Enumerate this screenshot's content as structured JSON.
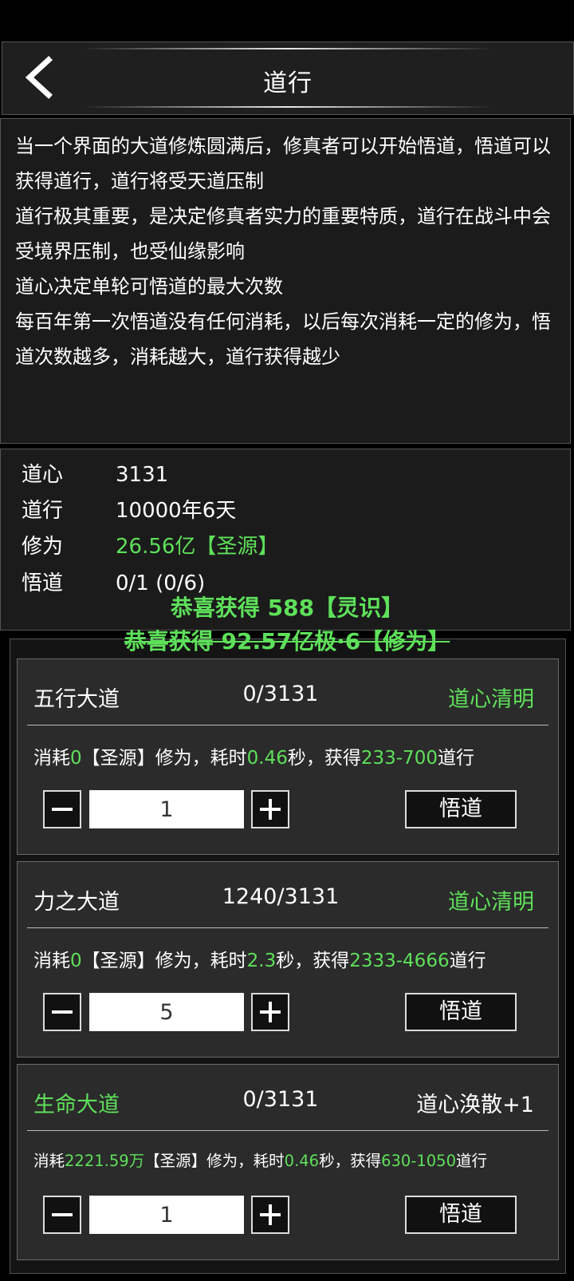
{
  "header": {
    "title": "道行"
  },
  "description": [
    "当一个界面的大道修炼圆满后，修真者可以开始悟道，悟道可以获得道行，道行将受天道压制",
    "道行极其重要，是决定修真者实力的重要特质，道行在战斗中会受境界压制，也受仙缘影响",
    "道心决定单轮可悟道的最大次数",
    "每百年第一次悟道没有任何消耗，以后每次消耗一定的修为，悟道次数越多，消耗越大，道行获得越少"
  ],
  "stats": {
    "daoxin": {
      "label": "道心",
      "value": "3131"
    },
    "daoxing": {
      "label": "道行",
      "value": "10000年6天"
    },
    "xiuwei": {
      "label": "修为",
      "value": "26.56亿【圣源】"
    },
    "wudao": {
      "label": "悟道",
      "value": "0/1 (0/6)"
    }
  },
  "toasts": [
    "恭喜获得 588【灵识】",
    "恭喜获得 92.57亿极·6【修为】"
  ],
  "cards": [
    {
      "name": "五行大道",
      "progress": "0/3131",
      "state": "道心清明",
      "cost": {
        "p1": "消耗",
        "v1": "0",
        "p2": "【圣源】修为，耗时",
        "v2": "0.46",
        "p3": "秒，获得",
        "v3": "233-700",
        "p4": "道行"
      },
      "qty": "1",
      "button": "悟道"
    },
    {
      "name": "力之大道",
      "progress": "1240/3131",
      "state": "道心清明",
      "cost": {
        "p1": "消耗",
        "v1": "0",
        "p2": "【圣源】修为，耗时",
        "v2": "2.3",
        "p3": "秒，获得",
        "v3": "2333-4666",
        "p4": "道行"
      },
      "qty": "5",
      "button": "悟道"
    },
    {
      "name": "生命大道",
      "progress": "0/3131",
      "state": "道心涣散+1",
      "cost": {
        "p1": "消耗",
        "v1": "2221.59万",
        "p2": "【圣源】修为，耗时",
        "v2": "0.46",
        "p3": "秒，获得",
        "v3": "630-1050",
        "p4": "道行"
      },
      "qty": "1",
      "button": "悟道"
    }
  ],
  "colors": {
    "accent_green": "#5ee05a",
    "panel": "#1b1b1b",
    "card": "#2b2b2b"
  },
  "icons": {
    "back": "chevron-left-icon",
    "minus": "minus-icon",
    "plus": "plus-icon"
  }
}
